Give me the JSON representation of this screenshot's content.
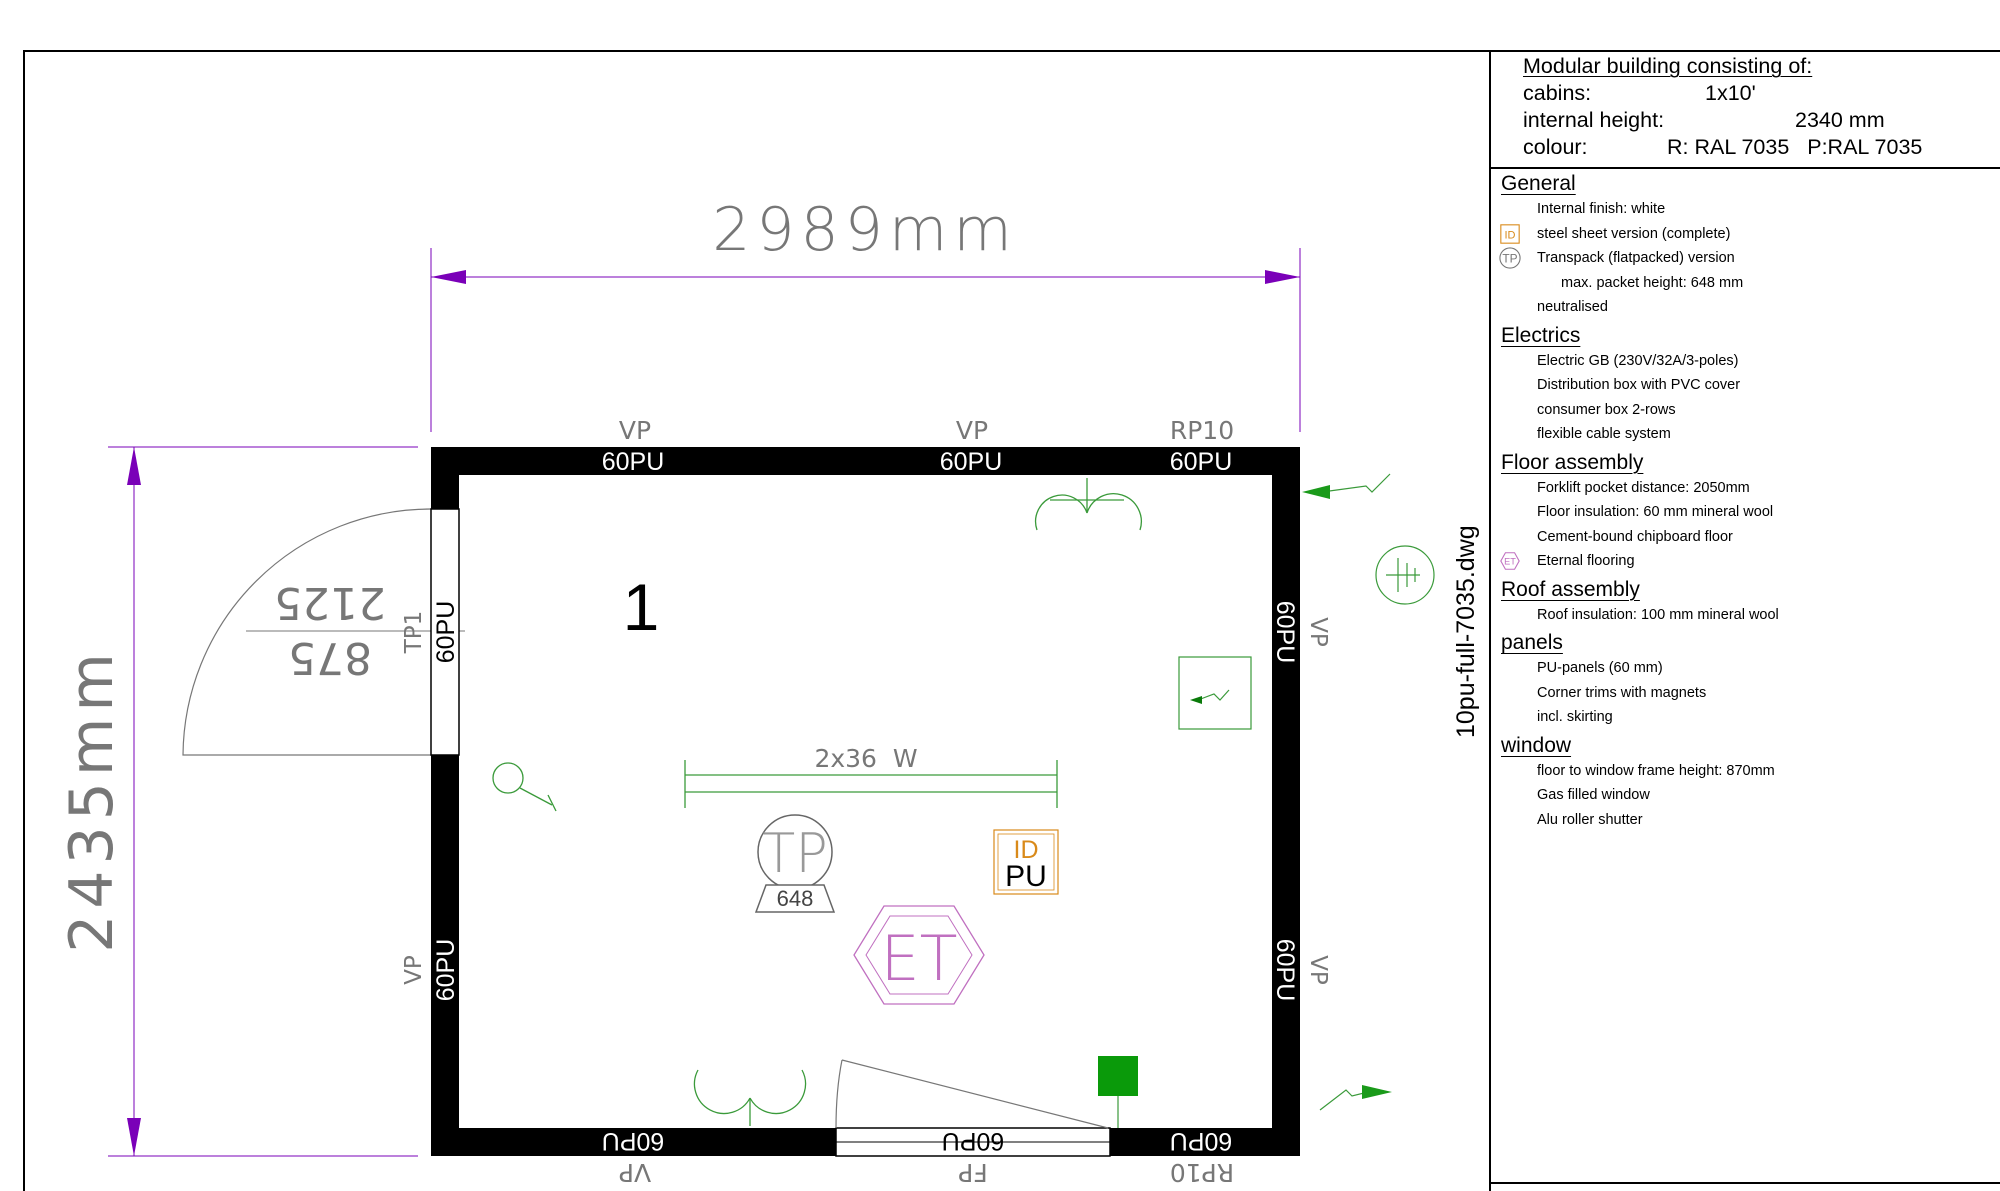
{
  "header": {
    "title": "Modular building consisting of:",
    "rows": [
      {
        "label": "cabins:",
        "value": "1x10'"
      },
      {
        "label": "internal height:",
        "value": "2340 mm"
      },
      {
        "label": "colour:",
        "value": "R: RAL 7035   P:RAL 7035"
      }
    ]
  },
  "filename": "10pu-full-7035.dwg",
  "sections": [
    {
      "title": "General",
      "items": [
        {
          "text": "Internal finish: white",
          "icon": ""
        },
        {
          "text": "steel sheet version (complete)",
          "icon": "id-icon"
        },
        {
          "text": "Transpack (flatpacked) version",
          "icon": "tp-icon"
        },
        {
          "text": "max. packet height: 648 mm",
          "icon": ""
        },
        {
          "text": "neutralised",
          "icon": ""
        }
      ]
    },
    {
      "title": "Electrics",
      "items": [
        {
          "text": "Electric GB (230V/32A/3-poles)",
          "icon": ""
        },
        {
          "text": "Distribution box with PVC cover",
          "icon": ""
        },
        {
          "text": "consumer box 2-rows",
          "icon": ""
        },
        {
          "text": "flexible cable system",
          "icon": ""
        }
      ]
    },
    {
      "title": "Floor assembly",
      "items": [
        {
          "text": "Forklift pocket distance: 2050mm",
          "icon": ""
        },
        {
          "text": "Floor insulation: 60 mm mineral wool",
          "icon": ""
        },
        {
          "text": "Cement-bound chipboard floor",
          "icon": ""
        },
        {
          "text": "Eternal flooring",
          "icon": "et-icon"
        }
      ]
    },
    {
      "title": "Roof assembly",
      "items": [
        {
          "text": "Roof insulation: 100 mm mineral wool",
          "icon": ""
        }
      ]
    },
    {
      "title": "panels",
      "items": [
        {
          "text": "PU-panels (60 mm)",
          "icon": ""
        },
        {
          "text": "Corner trims with magnets",
          "icon": ""
        },
        {
          "text": "incl. skirting",
          "icon": ""
        }
      ]
    },
    {
      "title": "window",
      "items": [
        {
          "text": "floor to window frame height: 870mm",
          "icon": ""
        },
        {
          "text": "Gas filled window",
          "icon": ""
        },
        {
          "text": "Alu roller shutter",
          "icon": ""
        }
      ]
    }
  ],
  "plan": {
    "dim_width": "2989mm",
    "dim_depth": "2435mm",
    "room_number": "1",
    "light_label": "2x36  W",
    "tp_badge_top": "TP",
    "tp_badge_value": "648",
    "id_badge_top": "ID",
    "id_badge_bottom": "PU",
    "et_badge": "ET",
    "door_dim_top": "2125",
    "door_dim_bottom": "875",
    "top_wall": [
      {
        "panel": "60PU",
        "code": "VP"
      },
      {
        "panel": "60PU",
        "code": "VP"
      },
      {
        "panel": "60PU",
        "code": "RP10"
      }
    ],
    "bottom_wall": [
      {
        "panel": "60PU",
        "code": "VP"
      },
      {
        "panel": "60PU",
        "code": "FP"
      },
      {
        "panel": "60PU",
        "code": "RP10"
      }
    ],
    "left_wall": [
      {
        "panel": "60PU",
        "code": "TP1"
      },
      {
        "panel": "60PU",
        "code": "VP"
      }
    ],
    "right_wall": [
      {
        "panel": "60PU",
        "code": "VP"
      },
      {
        "panel": "60PU",
        "code": "VP"
      }
    ],
    "colors": {
      "dimension": "#7a00b8",
      "electrics": "#3a9a3a",
      "et_pink": "#c070c0",
      "id_orange": "#d98a1a",
      "wall": "#000000"
    }
  }
}
